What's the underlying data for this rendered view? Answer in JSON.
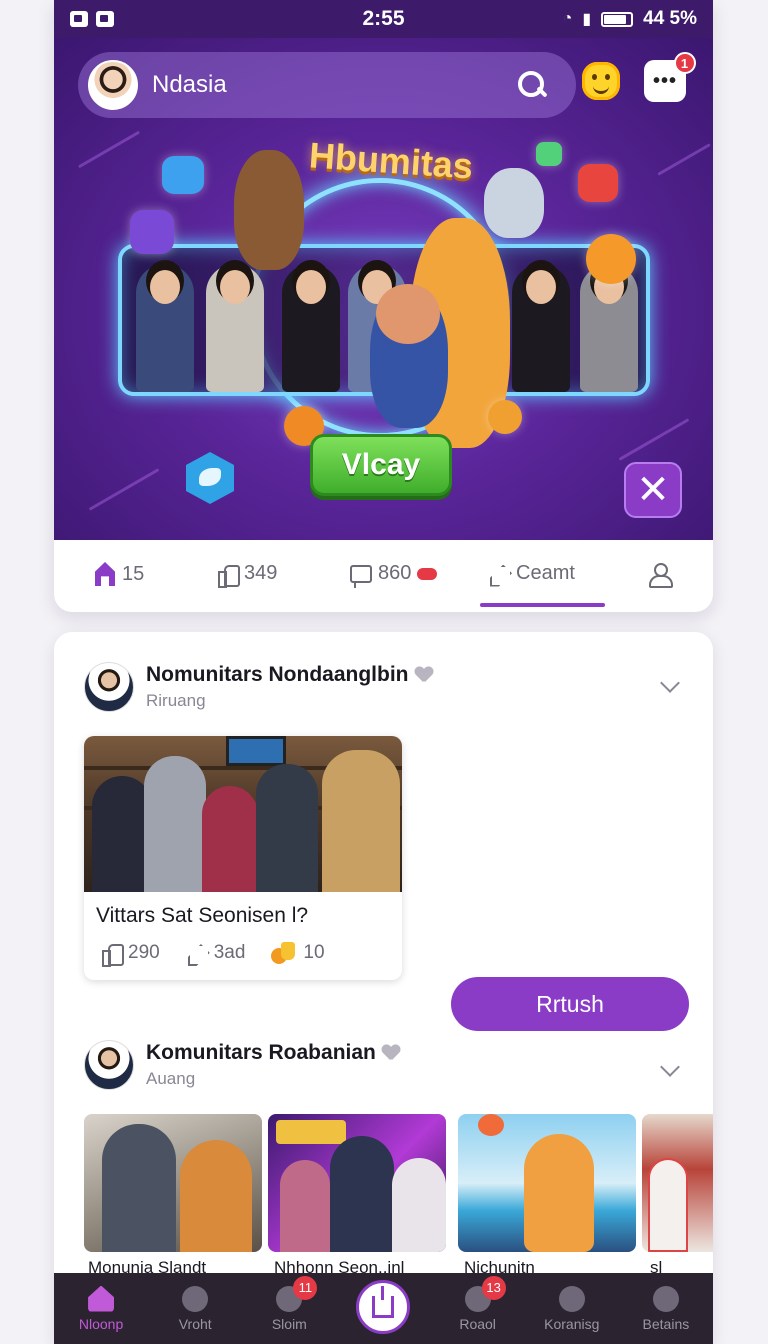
{
  "status_bar": {
    "time": "2:55",
    "battery": "44 5%",
    "battery_level": 0.85
  },
  "header": {
    "username": "Ndasia",
    "chat_badge": "1",
    "chat_icon_text": "•••"
  },
  "hero": {
    "title": "Hbumitas",
    "play_label": "Vlcay",
    "close_symbol": "✕"
  },
  "stats": [
    {
      "icon": "home-icon",
      "value": "15"
    },
    {
      "icon": "like-icon",
      "value": "349"
    },
    {
      "icon": "comment-icon",
      "value": "860"
    },
    {
      "icon": "share-icon",
      "label": "Ceamt"
    },
    {
      "icon": "profile-icon"
    }
  ],
  "posts": [
    {
      "title": "Nomunitars Nondaanglbin",
      "subtitle": "Riruang",
      "caption": "Vittars Sat Seonisen l?",
      "likes": "290",
      "shares": "3ad",
      "coins": "10"
    },
    {
      "title": "Komunitars Roabanian",
      "subtitle": "Auang"
    }
  ],
  "refresh_label": "Rrtush",
  "thumbnails": [
    {
      "label": "Monunia Slandt"
    },
    {
      "label": "Nhhonn Seon..inl"
    },
    {
      "label": "Nichunitn"
    },
    {
      "label": "sl"
    }
  ],
  "bottom_nav": [
    {
      "label": "Nloonp",
      "icon": "home-icon",
      "active": true
    },
    {
      "label": "Vroht",
      "icon": "search-icon"
    },
    {
      "label": "Sloim",
      "icon": "target-icon",
      "badge": "11"
    },
    {
      "label": "",
      "icon": "share-icon",
      "center": true
    },
    {
      "label": "Roaol",
      "icon": "chat-icon",
      "badge": "13"
    },
    {
      "label": "Koranisg",
      "icon": "search-icon"
    },
    {
      "label": "Betains",
      "icon": "profile-icon"
    }
  ],
  "colors": {
    "accent": "#8a3cc7",
    "status_bar": "#3d1a6a",
    "play_green": "#3fae2c",
    "badge_red": "#e63946"
  }
}
